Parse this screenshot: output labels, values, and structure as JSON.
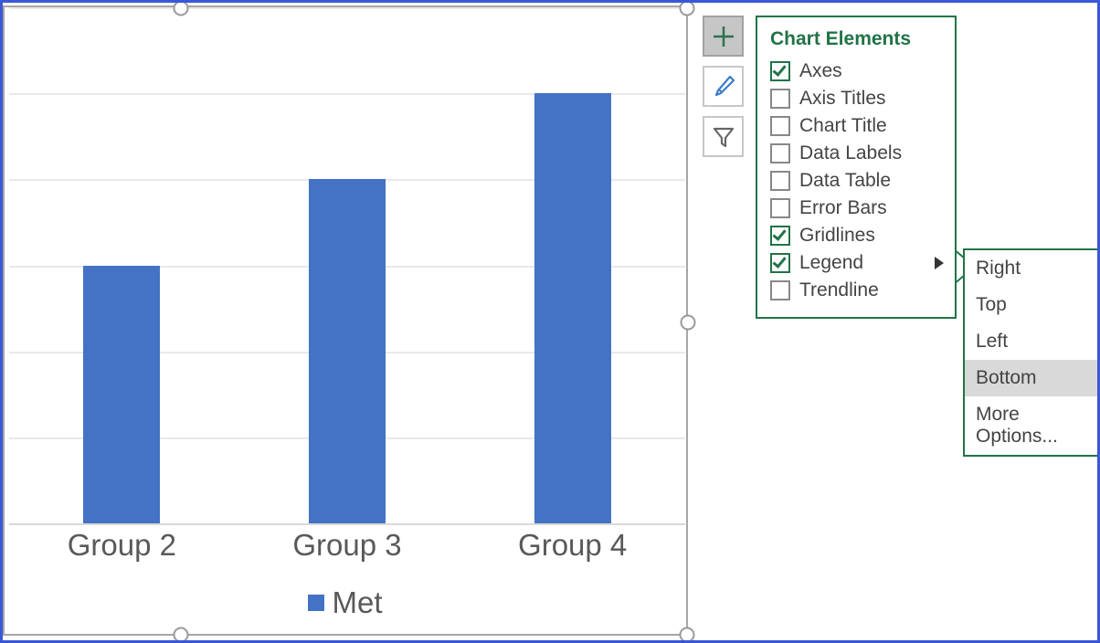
{
  "chart_data": {
    "type": "bar",
    "categories": [
      "Group 2",
      "Group 3",
      "Group 4"
    ],
    "values": [
      3,
      4,
      5
    ],
    "ylim": [
      0,
      6
    ],
    "gridline_step": 1,
    "series_name": "Met",
    "bar_color": "#4472c4",
    "legend_position": "bottom"
  },
  "side_buttons": {
    "plus": {
      "name": "chart-elements-button",
      "active": true
    },
    "brush": {
      "name": "chart-styles-button",
      "active": false
    },
    "filter": {
      "name": "chart-filters-button",
      "active": false
    }
  },
  "flyout": {
    "title": "Chart Elements",
    "items": [
      {
        "label": "Axes",
        "checked": true,
        "has_submenu": false
      },
      {
        "label": "Axis Titles",
        "checked": false,
        "has_submenu": false
      },
      {
        "label": "Chart Title",
        "checked": false,
        "has_submenu": false
      },
      {
        "label": "Data Labels",
        "checked": false,
        "has_submenu": false
      },
      {
        "label": "Data Table",
        "checked": false,
        "has_submenu": false
      },
      {
        "label": "Error Bars",
        "checked": false,
        "has_submenu": false
      },
      {
        "label": "Gridlines",
        "checked": true,
        "has_submenu": false
      },
      {
        "label": "Legend",
        "checked": true,
        "has_submenu": true
      },
      {
        "label": "Trendline",
        "checked": false,
        "has_submenu": false
      }
    ]
  },
  "submenu": {
    "items": [
      {
        "label": "Right",
        "selected": false
      },
      {
        "label": "Top",
        "selected": false
      },
      {
        "label": "Left",
        "selected": false
      },
      {
        "label": "Bottom",
        "selected": true
      },
      {
        "label": "More Options...",
        "selected": false
      }
    ]
  }
}
